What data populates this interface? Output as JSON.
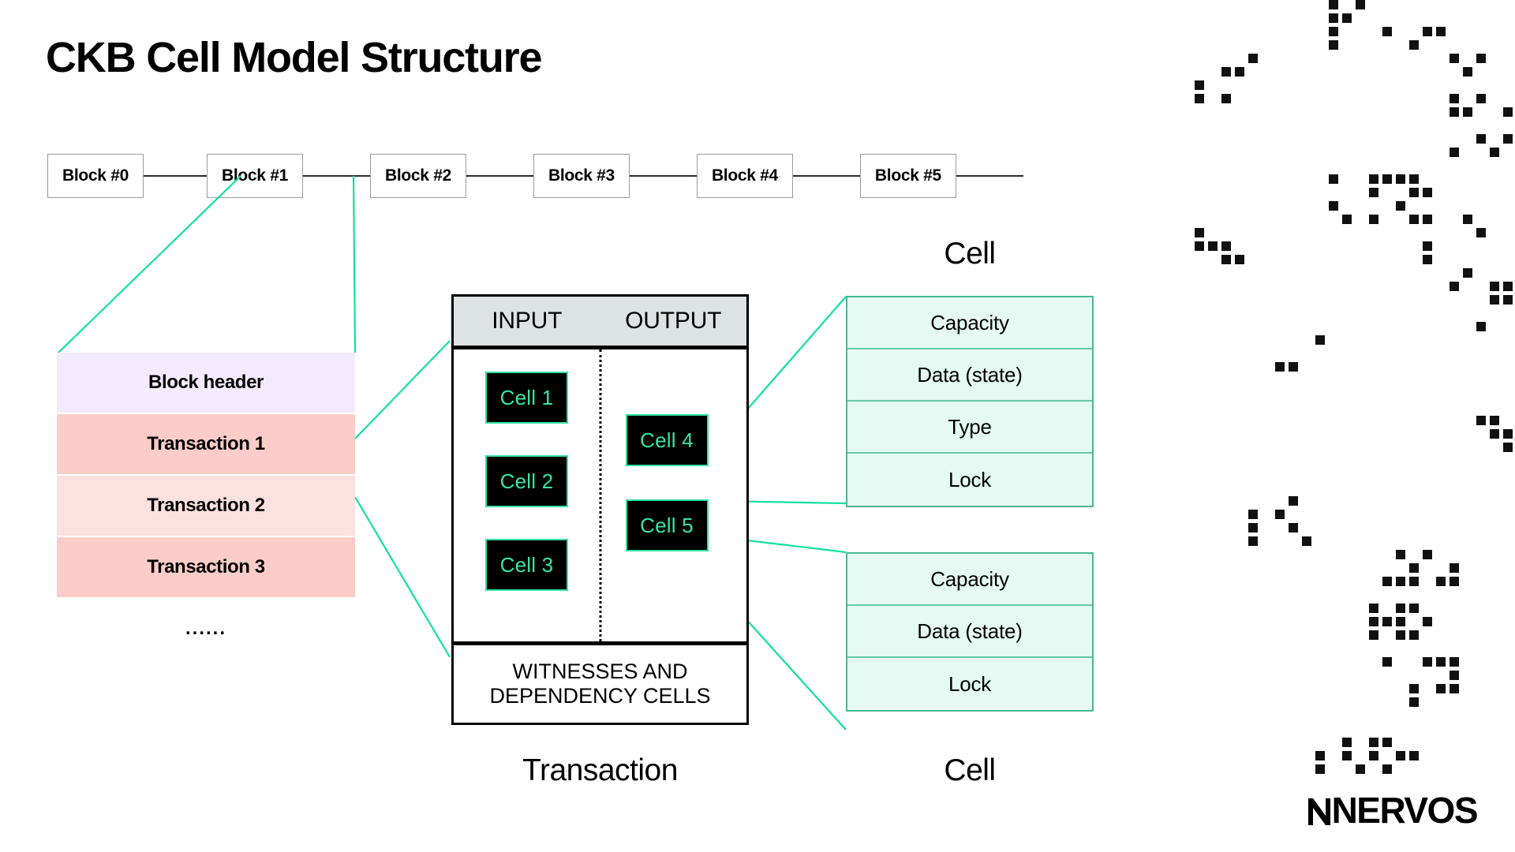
{
  "title": "CKB Cell Model Structure",
  "chain": {
    "blocks": [
      {
        "label": "Block #0"
      },
      {
        "label": "Block #1"
      },
      {
        "label": "Block #2"
      },
      {
        "label": "Block #3"
      },
      {
        "label": "Block #4"
      },
      {
        "label": "Block #5"
      }
    ]
  },
  "block_detail": {
    "rows": [
      {
        "label": "Block header",
        "color": "#f4eafd"
      },
      {
        "label": "Transaction 1",
        "color": "#fccdc8"
      },
      {
        "label": "Transaction 2",
        "color": "#fde1df"
      },
      {
        "label": "Transaction 3",
        "color": "#fccdc8"
      },
      {
        "label": "......",
        "color": "#ffffff"
      }
    ]
  },
  "transaction": {
    "caption": "Transaction",
    "headers": {
      "input": "INPUT",
      "output": "OUTPUT"
    },
    "input_cells": [
      {
        "label": "Cell 1"
      },
      {
        "label": "Cell 2"
      },
      {
        "label": "Cell 3"
      }
    ],
    "output_cells": [
      {
        "label": "Cell 4"
      },
      {
        "label": "Cell 5"
      }
    ],
    "footer_line1": "WITNESSES AND",
    "footer_line2": "DEPENDENCY CELLS"
  },
  "cell_tables": [
    {
      "caption": "Cell",
      "rows": [
        "Capacity",
        "Data (state)",
        "Type",
        "Lock"
      ]
    },
    {
      "caption": "Cell",
      "rows": [
        "Capacity",
        "Data (state)",
        "Lock"
      ]
    }
  ],
  "logo": {
    "text": "NERVOS"
  },
  "colors": {
    "accent_green": "#2fe3a2",
    "cell_text_green": "#35e6a4",
    "table_fill": "#e4faf2",
    "table_border": "#4bb795",
    "table_row_divider": "#68c9a8",
    "header_gray": "#dde2e2",
    "block_border": "#9b9b9b",
    "header_lavender": "#f4eafd",
    "tx_pink_dark": "#fccdc8",
    "tx_pink_light": "#fde1df",
    "black": "#000000"
  }
}
